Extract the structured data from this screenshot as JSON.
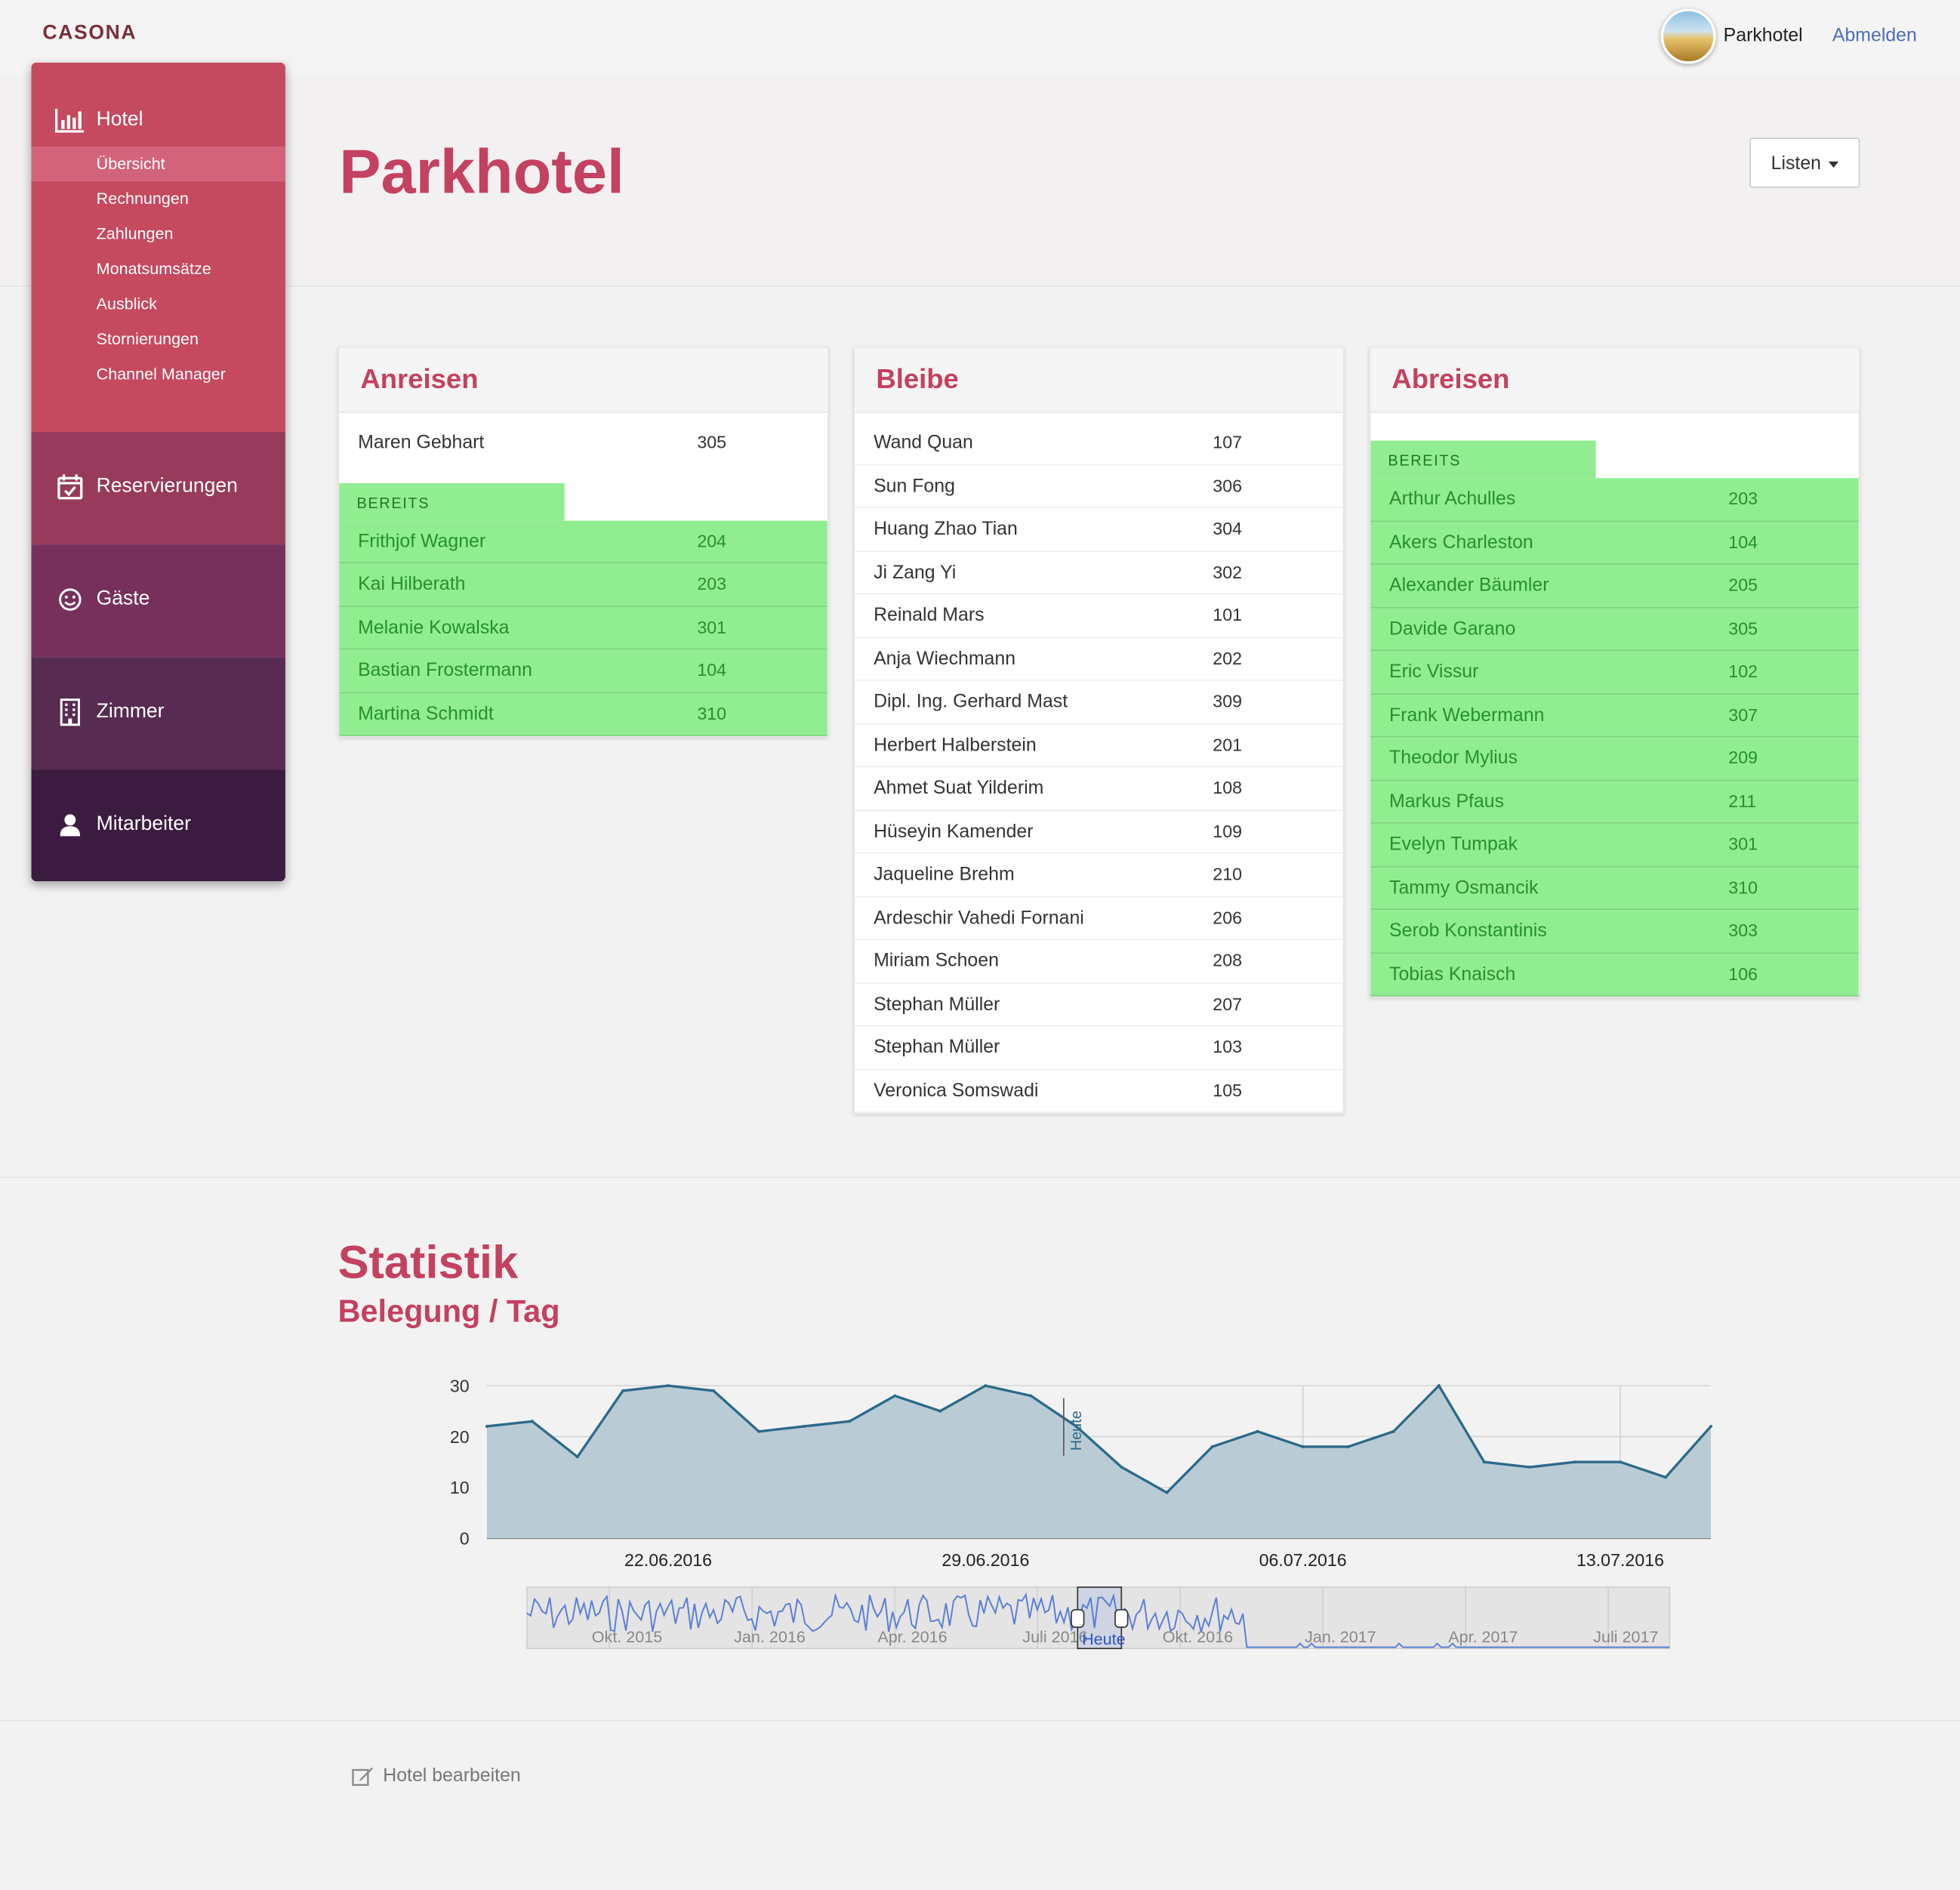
{
  "brand": "CASONA",
  "topbar": {
    "hotel_name": "Parkhotel",
    "logout": "Abmelden"
  },
  "page": {
    "title": "Parkhotel",
    "lists_button": "Listen"
  },
  "sidebar": {
    "hotel": {
      "label": "Hotel",
      "items": [
        "Übersicht",
        "Rechnungen",
        "Zahlungen",
        "Monatsumsätze",
        "Ausblick",
        "Stornierungen",
        "Channel Manager"
      ],
      "active": "Übersicht"
    },
    "reservierungen": "Reservierungen",
    "gaeste": "Gäste",
    "zimmer": "Zimmer",
    "mitarbeiter": "Mitarbeiter"
  },
  "arrivals": {
    "title": "Anreisen",
    "pending": [
      {
        "name": "Maren Gebhart",
        "room": "305"
      }
    ],
    "checked_in_label": "BEREITS EINGECHECKT",
    "checked_in": [
      {
        "name": "Frithjof Wagner",
        "room": "204"
      },
      {
        "name": "Kai Hilberath",
        "room": "203"
      },
      {
        "name": "Melanie Kowalska",
        "room": "301"
      },
      {
        "name": "Bastian Frostermann",
        "room": "104"
      },
      {
        "name": "Martina Schmidt",
        "room": "310"
      }
    ]
  },
  "stays": {
    "title": "Bleibe",
    "guests": [
      {
        "name": "Wand Quan",
        "room": "107"
      },
      {
        "name": "Sun Fong",
        "room": "306"
      },
      {
        "name": "Huang Zhao Tian",
        "room": "304"
      },
      {
        "name": "Ji Zang Yi",
        "room": "302"
      },
      {
        "name": "Reinald Mars",
        "room": "101"
      },
      {
        "name": "Anja Wiechmann",
        "room": "202"
      },
      {
        "name": "Dipl. Ing. Gerhard Mast",
        "room": "309"
      },
      {
        "name": "Herbert Halberstein",
        "room": "201"
      },
      {
        "name": "Ahmet Suat Yilderim",
        "room": "108"
      },
      {
        "name": "Hüseyin Kamender",
        "room": "109"
      },
      {
        "name": "Jaqueline Brehm",
        "room": "210"
      },
      {
        "name": "Ardeschir Vahedi Fornani",
        "room": "206"
      },
      {
        "name": "Miriam Schoen",
        "room": "208"
      },
      {
        "name": "Stephan Müller",
        "room": "207"
      },
      {
        "name": "Stephan Müller",
        "room": "103"
      },
      {
        "name": "Veronica Somswadi",
        "room": "105"
      }
    ]
  },
  "departures": {
    "title": "Abreisen",
    "checked_out_label": "BEREITS AUSGECHECKT",
    "checked_out": [
      {
        "name": "Arthur Achulles",
        "room": "203"
      },
      {
        "name": "Akers Charleston",
        "room": "104"
      },
      {
        "name": "Alexander Bäumler",
        "room": "205"
      },
      {
        "name": "Davide Garano",
        "room": "305"
      },
      {
        "name": "Eric Vissur",
        "room": "102"
      },
      {
        "name": "Frank Webermann",
        "room": "307"
      },
      {
        "name": "Theodor  Mylius",
        "room": "209"
      },
      {
        "name": "Markus Pfaus",
        "room": "211"
      },
      {
        "name": "Evelyn Tumpak",
        "room": "301"
      },
      {
        "name": "Tammy Osmancik",
        "room": "310"
      },
      {
        "name": "Serob Konstantinis",
        "room": "303"
      },
      {
        "name": "Tobias Knaisch",
        "room": "106"
      }
    ]
  },
  "statistics": {
    "title": "Statistik",
    "subtitle": "Belegung / Tag",
    "navigator_labels": [
      "Okt. 2015",
      "Jan. 2016",
      "Apr. 2016",
      "Juli 2016",
      "Okt. 2016",
      "Jan. 2017",
      "Apr. 2017",
      "Juli 2017"
    ],
    "navigator_marker": "Heute"
  },
  "chart_data": {
    "type": "area",
    "x": [
      "18.06.2016",
      "19.06.2016",
      "20.06.2016",
      "21.06.2016",
      "22.06.2016",
      "23.06.2016",
      "24.06.2016",
      "25.06.2016",
      "26.06.2016",
      "27.06.2016",
      "28.06.2016",
      "29.06.2016",
      "30.06.2016",
      "01.07.2016",
      "02.07.2016",
      "03.07.2016",
      "04.07.2016",
      "05.07.2016",
      "06.07.2016",
      "07.07.2016",
      "08.07.2016",
      "09.07.2016",
      "10.07.2016",
      "11.07.2016",
      "12.07.2016",
      "13.07.2016",
      "14.07.2016",
      "15.07.2016"
    ],
    "values": [
      22,
      23,
      16,
      29,
      30,
      29,
      21,
      22,
      23,
      28,
      25,
      30,
      28,
      22,
      14,
      9,
      18,
      21,
      18,
      18,
      21,
      30,
      15,
      14,
      15,
      15,
      12,
      22
    ],
    "x_ticks": [
      "22.06.2016",
      "29.06.2016",
      "06.07.2016",
      "13.07.2016"
    ],
    "y_ticks": [
      0,
      10,
      20,
      30
    ],
    "ylim": [
      0,
      30
    ],
    "marker_label": "Heute",
    "marker_x": "01.07.2016",
    "color": "#2c6a8a",
    "fill": "#b9ccd5",
    "grid": true
  },
  "footer": {
    "edit_label": "Hotel bearbeiten"
  },
  "colors": {
    "accent": "#c4415f",
    "checked": "#90ee90",
    "checked_text": "#279127"
  }
}
